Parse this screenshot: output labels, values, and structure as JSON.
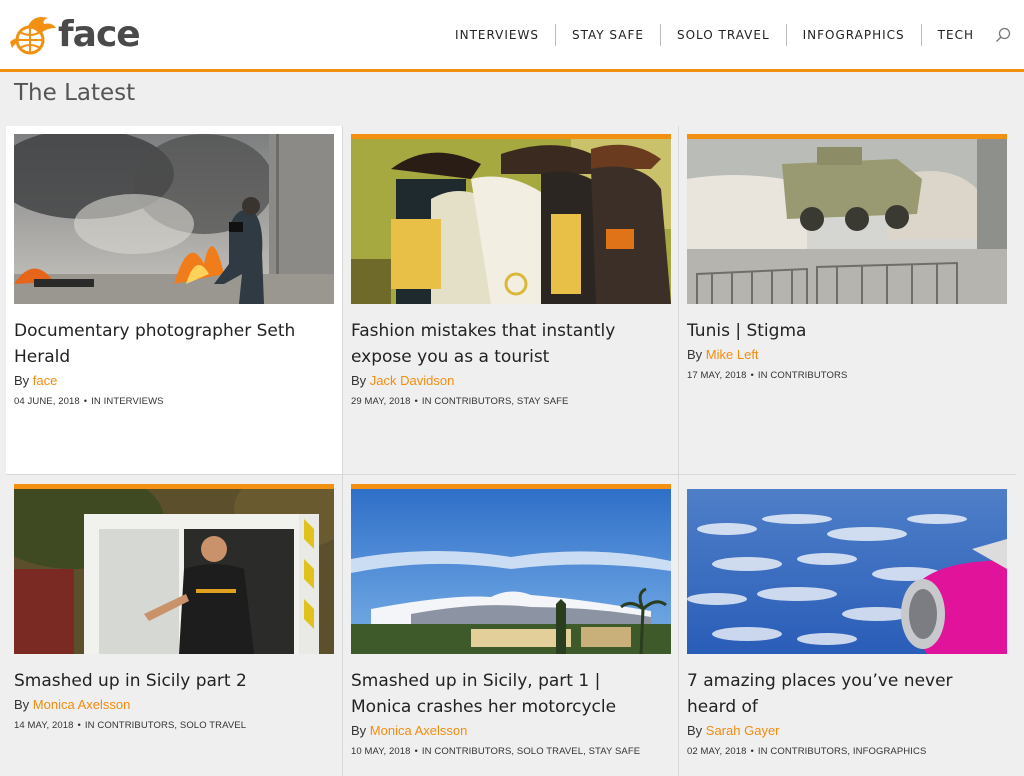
{
  "brand": {
    "name": "face",
    "accent": "#f29111",
    "author_color": "#f28c0f"
  },
  "nav": {
    "items": [
      "INTERVIEWS",
      "STAY SAFE",
      "SOLO TRAVEL",
      "INFOGRAPHICS",
      "TECH"
    ],
    "search_icon": "search-icon"
  },
  "main": {
    "section_title": "The Latest",
    "by_label": "By",
    "in_label": "IN",
    "posts": [
      {
        "title": "Documentary photographer Seth Herald",
        "author": "face",
        "date": "04 JUNE, 2018",
        "categories": "INTERVIEWS"
      },
      {
        "title": "Fashion mistakes that instantly expose you as a tourist",
        "author": "Jack Davidson",
        "date": "29 MAY, 2018",
        "categories": "CONTRIBUTORS, STAY SAFE"
      },
      {
        "title": "Tunis | Stigma",
        "author": "Mike Left",
        "date": "17 MAY, 2018",
        "categories": "CONTRIBUTORS"
      },
      {
        "title": "Smashed up in Sicily part 2",
        "author": "Monica Axelsson",
        "date": "14 MAY, 2018",
        "categories": "CONTRIBUTORS, SOLO TRAVEL"
      },
      {
        "title": "Smashed up in Sicily, part 1 | Monica crashes her motorcycle",
        "author": "Monica Axelsson",
        "date": "10 MAY, 2018",
        "categories": "CONTRIBUTORS, SOLO TRAVEL, STAY SAFE"
      },
      {
        "title": "7 amazing places you’ve never heard of",
        "author": "Sarah Gayer",
        "date": "02 MAY, 2018",
        "categories": "CONTRIBUTORS, INFOGRAPHICS"
      }
    ]
  }
}
